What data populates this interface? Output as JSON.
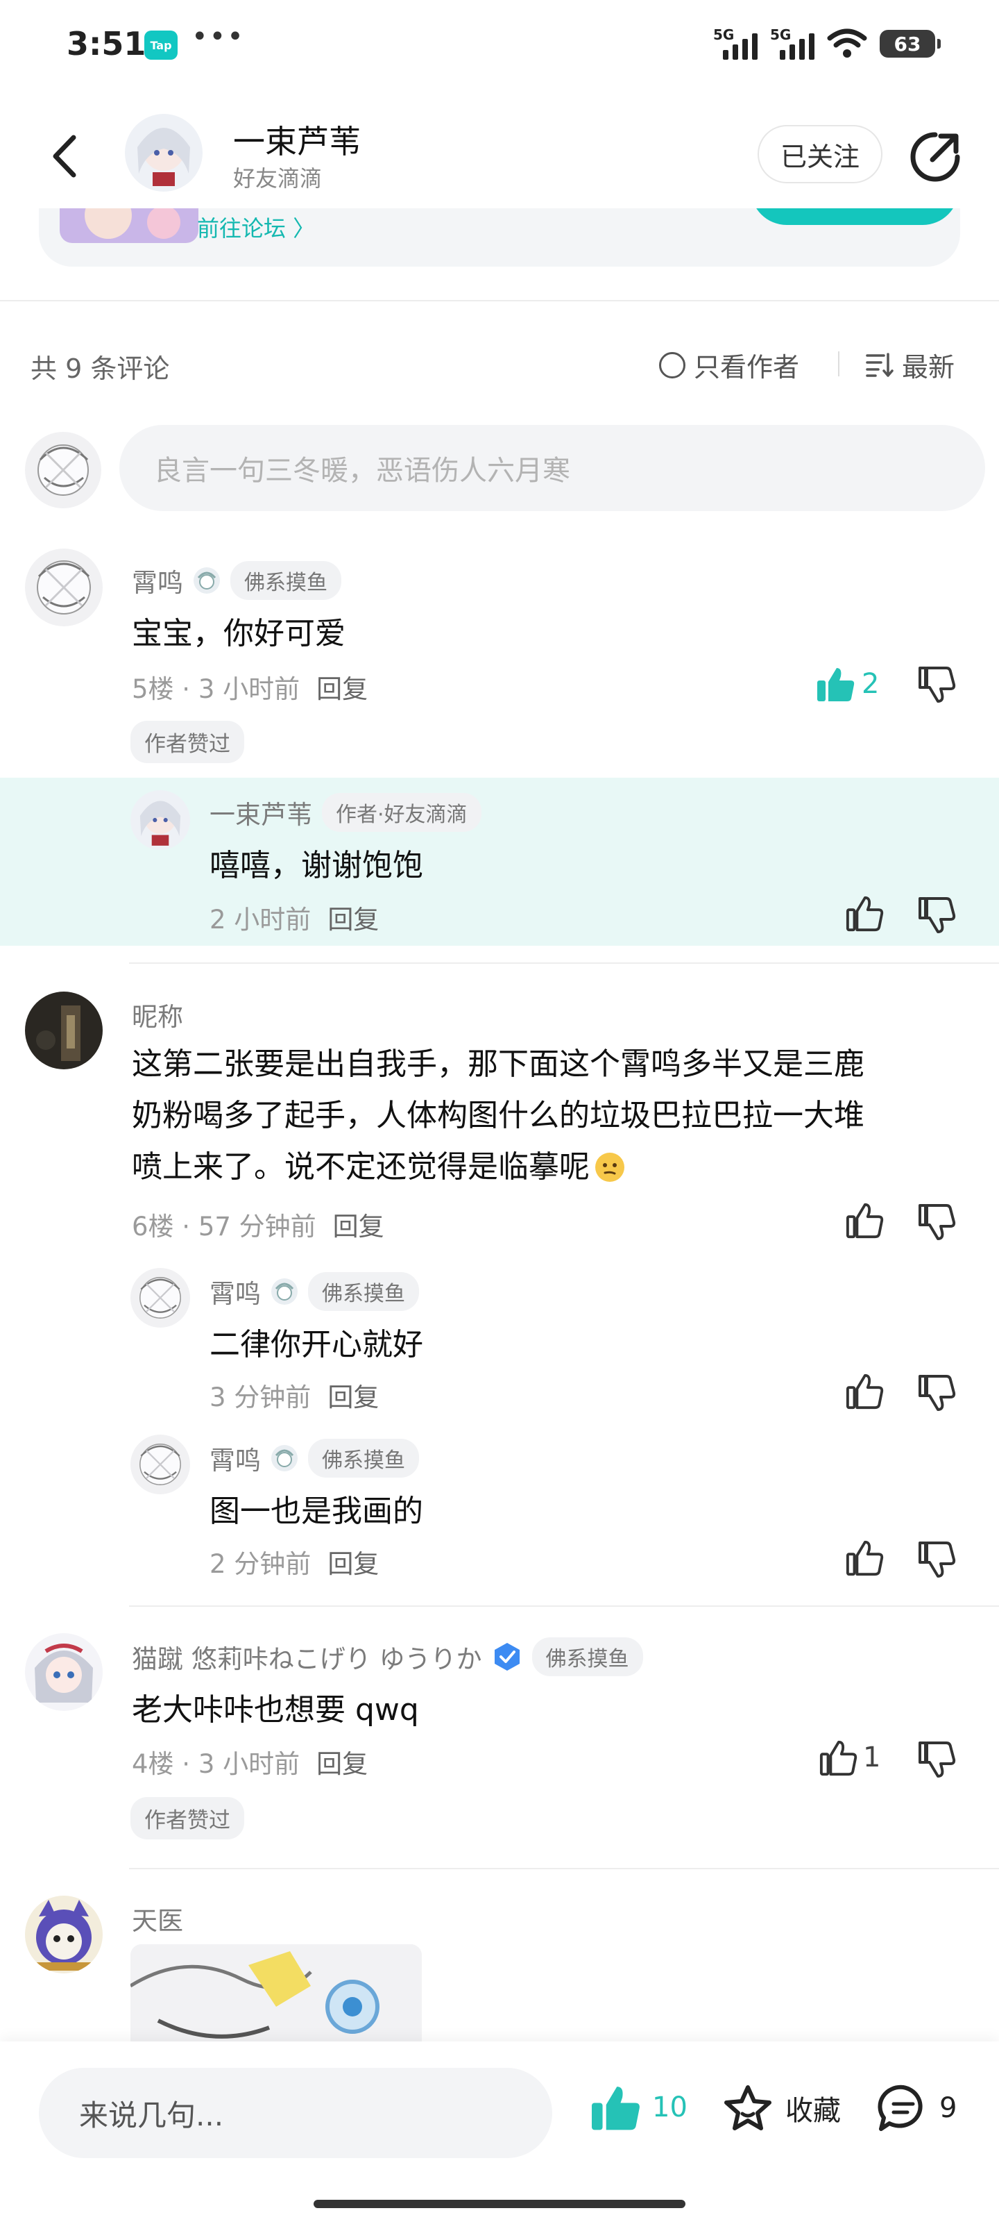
{
  "status_bar": {
    "time": "3:51",
    "app_badge": "Tap",
    "more": "•••",
    "network_1": "5G",
    "network_2": "5G",
    "battery": "63"
  },
  "header": {
    "author_name": "一束芦苇",
    "author_sub": "好友滴滴",
    "follow_label": "已关注"
  },
  "forum": {
    "link": "前往论坛 〉"
  },
  "comments_bar": {
    "count": "共 9 条评论",
    "only_author": "只看作者",
    "sort": "最新"
  },
  "composer": {
    "placeholder": "良言一句三冬暖，恶语伤人六月寒"
  },
  "comments": [
    {
      "user": "霄鸣",
      "badge": "佛系摸鱼",
      "text": "宝宝，你好可爱",
      "floor": "5楼 · 3 小时前",
      "reply": "回复",
      "likes": "2",
      "author_liked": "作者赞过",
      "replies": [
        {
          "user": "一束芦苇",
          "badge": "作者·好友滴滴",
          "text": "嘻嘻，谢谢饱饱",
          "time": "2 小时前",
          "reply": "回复"
        }
      ]
    },
    {
      "user": "昵称",
      "text_lines": [
        "这第二张要是出自我手，那下面这个霄鸣多半又是三鹿",
        "奶粉喝多了起手，人体构图什么的垃圾巴拉巴拉一大堆",
        "喷上来了。说不定还觉得是临摹呢"
      ],
      "floor": "6楼 · 57 分钟前",
      "reply": "回复",
      "replies": [
        {
          "user": "霄鸣",
          "badge": "佛系摸鱼",
          "text": "二律你开心就好",
          "time": "3 分钟前",
          "reply": "回复"
        },
        {
          "user": "霄鸣",
          "badge": "佛系摸鱼",
          "text": "图一也是我画的",
          "time": "2 分钟前",
          "reply": "回复"
        }
      ]
    },
    {
      "user": "猫蹴 悠莉咔ねこげり ゆうりか",
      "badge": "佛系摸鱼",
      "text": "老大咔咔也想要 qwq",
      "floor": "4楼 · 3 小时前",
      "reply": "回复",
      "likes": "1",
      "author_liked": "作者赞过"
    },
    {
      "user": "天医"
    }
  ],
  "bottom_bar": {
    "input_placeholder": "来说几句...",
    "likes": "10",
    "favorite": "收藏",
    "comments": "9"
  },
  "colors": {
    "accent": "#25c2b6",
    "highlight_bg": "#e8f8f6"
  }
}
